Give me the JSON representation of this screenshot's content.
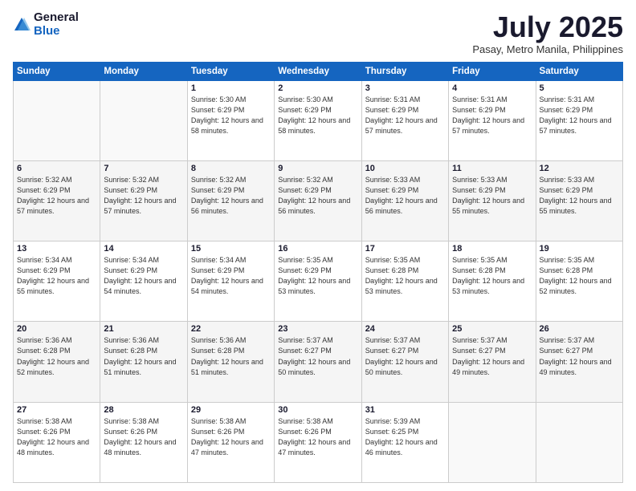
{
  "logo": {
    "general": "General",
    "blue": "Blue"
  },
  "header": {
    "month": "July 2025",
    "location": "Pasay, Metro Manila, Philippines"
  },
  "weekdays": [
    "Sunday",
    "Monday",
    "Tuesday",
    "Wednesday",
    "Thursday",
    "Friday",
    "Saturday"
  ],
  "weeks": [
    [
      {
        "day": "",
        "info": ""
      },
      {
        "day": "",
        "info": ""
      },
      {
        "day": "1",
        "info": "Sunrise: 5:30 AM\nSunset: 6:29 PM\nDaylight: 12 hours and 58 minutes."
      },
      {
        "day": "2",
        "info": "Sunrise: 5:30 AM\nSunset: 6:29 PM\nDaylight: 12 hours and 58 minutes."
      },
      {
        "day": "3",
        "info": "Sunrise: 5:31 AM\nSunset: 6:29 PM\nDaylight: 12 hours and 57 minutes."
      },
      {
        "day": "4",
        "info": "Sunrise: 5:31 AM\nSunset: 6:29 PM\nDaylight: 12 hours and 57 minutes."
      },
      {
        "day": "5",
        "info": "Sunrise: 5:31 AM\nSunset: 6:29 PM\nDaylight: 12 hours and 57 minutes."
      }
    ],
    [
      {
        "day": "6",
        "info": "Sunrise: 5:32 AM\nSunset: 6:29 PM\nDaylight: 12 hours and 57 minutes."
      },
      {
        "day": "7",
        "info": "Sunrise: 5:32 AM\nSunset: 6:29 PM\nDaylight: 12 hours and 57 minutes."
      },
      {
        "day": "8",
        "info": "Sunrise: 5:32 AM\nSunset: 6:29 PM\nDaylight: 12 hours and 56 minutes."
      },
      {
        "day": "9",
        "info": "Sunrise: 5:32 AM\nSunset: 6:29 PM\nDaylight: 12 hours and 56 minutes."
      },
      {
        "day": "10",
        "info": "Sunrise: 5:33 AM\nSunset: 6:29 PM\nDaylight: 12 hours and 56 minutes."
      },
      {
        "day": "11",
        "info": "Sunrise: 5:33 AM\nSunset: 6:29 PM\nDaylight: 12 hours and 55 minutes."
      },
      {
        "day": "12",
        "info": "Sunrise: 5:33 AM\nSunset: 6:29 PM\nDaylight: 12 hours and 55 minutes."
      }
    ],
    [
      {
        "day": "13",
        "info": "Sunrise: 5:34 AM\nSunset: 6:29 PM\nDaylight: 12 hours and 55 minutes."
      },
      {
        "day": "14",
        "info": "Sunrise: 5:34 AM\nSunset: 6:29 PM\nDaylight: 12 hours and 54 minutes."
      },
      {
        "day": "15",
        "info": "Sunrise: 5:34 AM\nSunset: 6:29 PM\nDaylight: 12 hours and 54 minutes."
      },
      {
        "day": "16",
        "info": "Sunrise: 5:35 AM\nSunset: 6:29 PM\nDaylight: 12 hours and 53 minutes."
      },
      {
        "day": "17",
        "info": "Sunrise: 5:35 AM\nSunset: 6:28 PM\nDaylight: 12 hours and 53 minutes."
      },
      {
        "day": "18",
        "info": "Sunrise: 5:35 AM\nSunset: 6:28 PM\nDaylight: 12 hours and 53 minutes."
      },
      {
        "day": "19",
        "info": "Sunrise: 5:35 AM\nSunset: 6:28 PM\nDaylight: 12 hours and 52 minutes."
      }
    ],
    [
      {
        "day": "20",
        "info": "Sunrise: 5:36 AM\nSunset: 6:28 PM\nDaylight: 12 hours and 52 minutes."
      },
      {
        "day": "21",
        "info": "Sunrise: 5:36 AM\nSunset: 6:28 PM\nDaylight: 12 hours and 51 minutes."
      },
      {
        "day": "22",
        "info": "Sunrise: 5:36 AM\nSunset: 6:28 PM\nDaylight: 12 hours and 51 minutes."
      },
      {
        "day": "23",
        "info": "Sunrise: 5:37 AM\nSunset: 6:27 PM\nDaylight: 12 hours and 50 minutes."
      },
      {
        "day": "24",
        "info": "Sunrise: 5:37 AM\nSunset: 6:27 PM\nDaylight: 12 hours and 50 minutes."
      },
      {
        "day": "25",
        "info": "Sunrise: 5:37 AM\nSunset: 6:27 PM\nDaylight: 12 hours and 49 minutes."
      },
      {
        "day": "26",
        "info": "Sunrise: 5:37 AM\nSunset: 6:27 PM\nDaylight: 12 hours and 49 minutes."
      }
    ],
    [
      {
        "day": "27",
        "info": "Sunrise: 5:38 AM\nSunset: 6:26 PM\nDaylight: 12 hours and 48 minutes."
      },
      {
        "day": "28",
        "info": "Sunrise: 5:38 AM\nSunset: 6:26 PM\nDaylight: 12 hours and 48 minutes."
      },
      {
        "day": "29",
        "info": "Sunrise: 5:38 AM\nSunset: 6:26 PM\nDaylight: 12 hours and 47 minutes."
      },
      {
        "day": "30",
        "info": "Sunrise: 5:38 AM\nSunset: 6:26 PM\nDaylight: 12 hours and 47 minutes."
      },
      {
        "day": "31",
        "info": "Sunrise: 5:39 AM\nSunset: 6:25 PM\nDaylight: 12 hours and 46 minutes."
      },
      {
        "day": "",
        "info": ""
      },
      {
        "day": "",
        "info": ""
      }
    ]
  ]
}
